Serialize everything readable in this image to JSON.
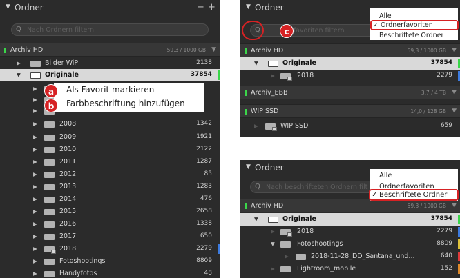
{
  "colors": {
    "accent_red": "#d62224",
    "volume_led": "#3bd64a",
    "bar_green": "#3bd64a",
    "bar_blue": "#3c7be0",
    "bar_red": "#e03a3a",
    "bar_yellow": "#e0c23a",
    "bar_orange": "#e08a2a"
  },
  "left": {
    "title": "Ordner",
    "search_placeholder": "Nach Ordnern filtern",
    "volume": {
      "name": "Archiv HD",
      "size": "59,3 / 1000 GB"
    },
    "rows": [
      {
        "name": "Bilder WiP",
        "count": "2138"
      },
      {
        "name": "Originale",
        "count": "37854"
      },
      {
        "name": "",
        "count": ""
      },
      {
        "name": "",
        "count": ""
      },
      {
        "name": "",
        "count": ""
      },
      {
        "name": "2008",
        "count": "1342"
      },
      {
        "name": "2009",
        "count": "1921"
      },
      {
        "name": "2010",
        "count": "2122"
      },
      {
        "name": "2011",
        "count": "1287"
      },
      {
        "name": "2012",
        "count": "85"
      },
      {
        "name": "2013",
        "count": "1283"
      },
      {
        "name": "2014",
        "count": "476"
      },
      {
        "name": "2015",
        "count": "2658"
      },
      {
        "name": "2016",
        "count": "1338"
      },
      {
        "name": "2017",
        "count": "650"
      },
      {
        "name": "2018",
        "count": "2279"
      },
      {
        "name": "Fotoshootings",
        "count": "8809"
      },
      {
        "name": "Handyfotos",
        "count": "48"
      }
    ],
    "menu": {
      "item_a": "Als Favorit markieren",
      "item_b": "Farbbeschriftung hinzufügen"
    }
  },
  "rtop": {
    "title": "Ordner",
    "search_placeholder": "nerfavoriten filtern",
    "vol1": {
      "name": "Archiv HD",
      "size": "59,3 / 1000 GB"
    },
    "rows1": [
      {
        "name": "Originale",
        "count": "37854"
      },
      {
        "name": "2018",
        "count": "2279"
      }
    ],
    "vol2": {
      "name": "Archiv_EBB",
      "size": "3,7 / 4 TB"
    },
    "vol3": {
      "name": "WIP SSD",
      "size": "14,0 / 128 GB"
    },
    "rows3": [
      {
        "name": "WIP SSD",
        "count": "659"
      }
    ],
    "dropdown": {
      "alle": "Alle",
      "fav": "Ordnerfavoriten",
      "besch": "Beschriftete Ordner"
    }
  },
  "rbot": {
    "title": "Ordner",
    "search_placeholder": "Nach beschrifteten Ordnern filt",
    "volume": {
      "name": "Archiv HD",
      "size": "59,3 / 1000 GB"
    },
    "rows": [
      {
        "name": "Originale",
        "count": "37854"
      },
      {
        "name": "2018",
        "count": "2279"
      },
      {
        "name": "Fotoshootings",
        "count": "8809"
      },
      {
        "name": "2018-11-28_DD_Santana_und...",
        "count": "640"
      },
      {
        "name": "Lightroom_mobile",
        "count": "152"
      }
    ],
    "dropdown": {
      "alle": "Alle",
      "fav": "Ordnerfavoriten",
      "besch": "Beschriftete Ordner"
    }
  },
  "badges": {
    "a": "a",
    "b": "b",
    "c": "c"
  },
  "check": "✓"
}
